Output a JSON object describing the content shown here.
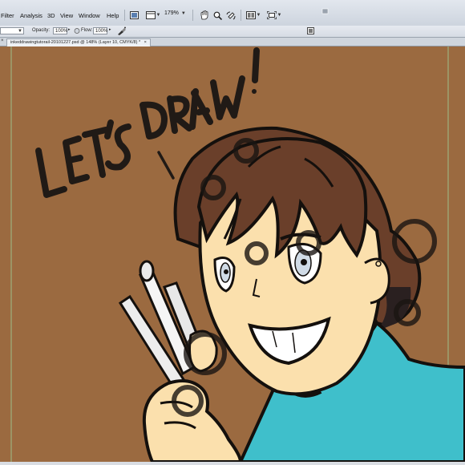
{
  "menu": {
    "items": [
      "Filter",
      "Analysis",
      "3D",
      "View",
      "Window",
      "Help"
    ]
  },
  "toolbar": {
    "zoom_value": "179%"
  },
  "options": {
    "opacity_label": "Opacity:",
    "opacity_value": "100%",
    "flow_label": "Flow:",
    "flow_value": "100%"
  },
  "document": {
    "tab_title": "inkeddrawingtutorail-20101227.psd @ 148% (Layer 10, CMYK/8) *"
  },
  "artwork": {
    "headline": "LET'S DRAW!",
    "background_color": "#9b6a40",
    "hair_color": "#6a3f2a",
    "skin_color": "#fbe0ad",
    "shirt_color": "#3fbfcb"
  },
  "icons": [
    "hand-tool-icon",
    "zoom-tool-icon",
    "rotate-view-icon",
    "arrange-documents-icon",
    "screen-mode-icon",
    "airbrush-icon",
    "tablet-pressure-icon",
    "brush-panel-icon",
    "mini-bridge-icon"
  ]
}
